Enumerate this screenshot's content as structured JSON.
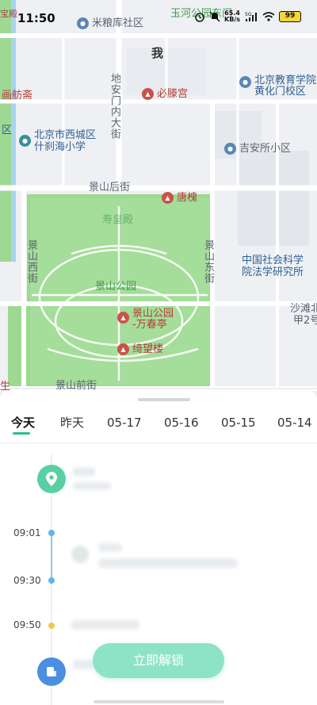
{
  "status_bar": {
    "time": "11:50",
    "speed": "65.4",
    "speed_unit": "KB/s",
    "network": "5G",
    "battery": "99"
  },
  "map": {
    "labels": {
      "milin": "米粮库社区",
      "wo": "我",
      "yuhe": "玉河公园东门",
      "dianan": "地安门内大街",
      "xizhou": "必滕宫",
      "beijing_edu_1": "北京教育学院",
      "beijing_edu_2": "黄化门校区",
      "fangshan": "画舫斋",
      "xicheng_1": "北京市西城区",
      "xicheng_2": "什刹海小学",
      "jian": "吉安所小区",
      "jingshan_hou": "景山后街",
      "tanghuai": "唐槐",
      "shouhuang": "寿皇殿",
      "jingshan_xi": "景山西街",
      "jingshan_dong": "景山东街",
      "jingshan_park": "景山公园",
      "cass_1": "中国社会科学",
      "cass_2": "院法学研究所",
      "wanchun_1": "景山公园",
      "wanchun_2": "-万春亭",
      "qiwang": "绮望楼",
      "shatan_1": "沙滩北",
      "shatan_2": "甲2号",
      "jingshan_qian": "景山前街",
      "left_dian": "宝殿",
      "left_qu": "区",
      "left_sheng": "生"
    },
    "colors": {
      "park": "#9ed993",
      "park_edge": "#8fcf85",
      "road": "#ffffff",
      "water": "#a9d3ee",
      "block": "#e6e9ee"
    }
  },
  "sheet": {
    "tabs": [
      {
        "label": "今天",
        "active": true
      },
      {
        "label": "昨天",
        "active": false
      },
      {
        "label": "05-17",
        "active": false
      },
      {
        "label": "05-16",
        "active": false
      },
      {
        "label": "05-15",
        "active": false
      },
      {
        "label": "05-14",
        "active": false
      }
    ],
    "timeline": {
      "times": [
        "09:01",
        "09:30",
        "09:50"
      ],
      "colors": {
        "accent": "#29c28a",
        "location": "#58d0a3",
        "travel": "#5cb6ea",
        "stop": "#f3c94a",
        "car": "#4b8fe0"
      }
    },
    "unlock_button": "立即解锁"
  }
}
